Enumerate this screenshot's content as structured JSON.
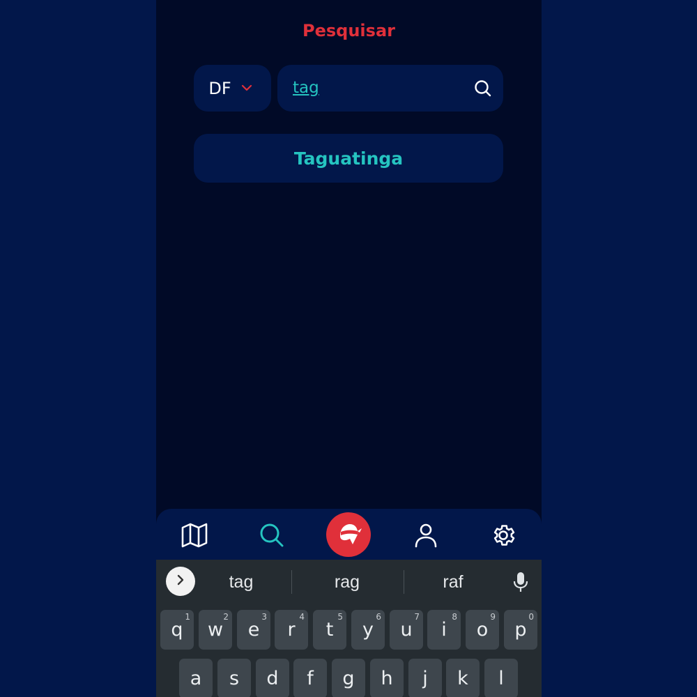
{
  "header": {
    "title": "Pesquisar"
  },
  "search": {
    "state_value": "DF",
    "query": "tag"
  },
  "results": [
    {
      "label": "Taguatinga"
    }
  ],
  "bottom_nav": {
    "items": [
      {
        "icon": "map-icon"
      },
      {
        "icon": "search-icon",
        "active": true
      },
      {
        "icon": "ninja-logo-icon"
      },
      {
        "icon": "user-icon"
      },
      {
        "icon": "gear-icon"
      }
    ]
  },
  "keyboard": {
    "suggestions": [
      "tag",
      "rag",
      "raf"
    ],
    "row1": [
      {
        "k": "q",
        "h": "1"
      },
      {
        "k": "w",
        "h": "2"
      },
      {
        "k": "e",
        "h": "3"
      },
      {
        "k": "r",
        "h": "4"
      },
      {
        "k": "t",
        "h": "5"
      },
      {
        "k": "y",
        "h": "6"
      },
      {
        "k": "u",
        "h": "7"
      },
      {
        "k": "i",
        "h": "8"
      },
      {
        "k": "o",
        "h": "9"
      },
      {
        "k": "p",
        "h": "0"
      }
    ],
    "row2": [
      {
        "k": "a"
      },
      {
        "k": "s"
      },
      {
        "k": "d"
      },
      {
        "k": "f"
      },
      {
        "k": "g"
      },
      {
        "k": "h"
      },
      {
        "k": "j"
      },
      {
        "k": "k"
      },
      {
        "k": "l"
      }
    ]
  },
  "colors": {
    "accent_red": "#e0303a",
    "accent_teal": "#25c4c0",
    "panel": "#02174a",
    "background": "#010a27"
  }
}
